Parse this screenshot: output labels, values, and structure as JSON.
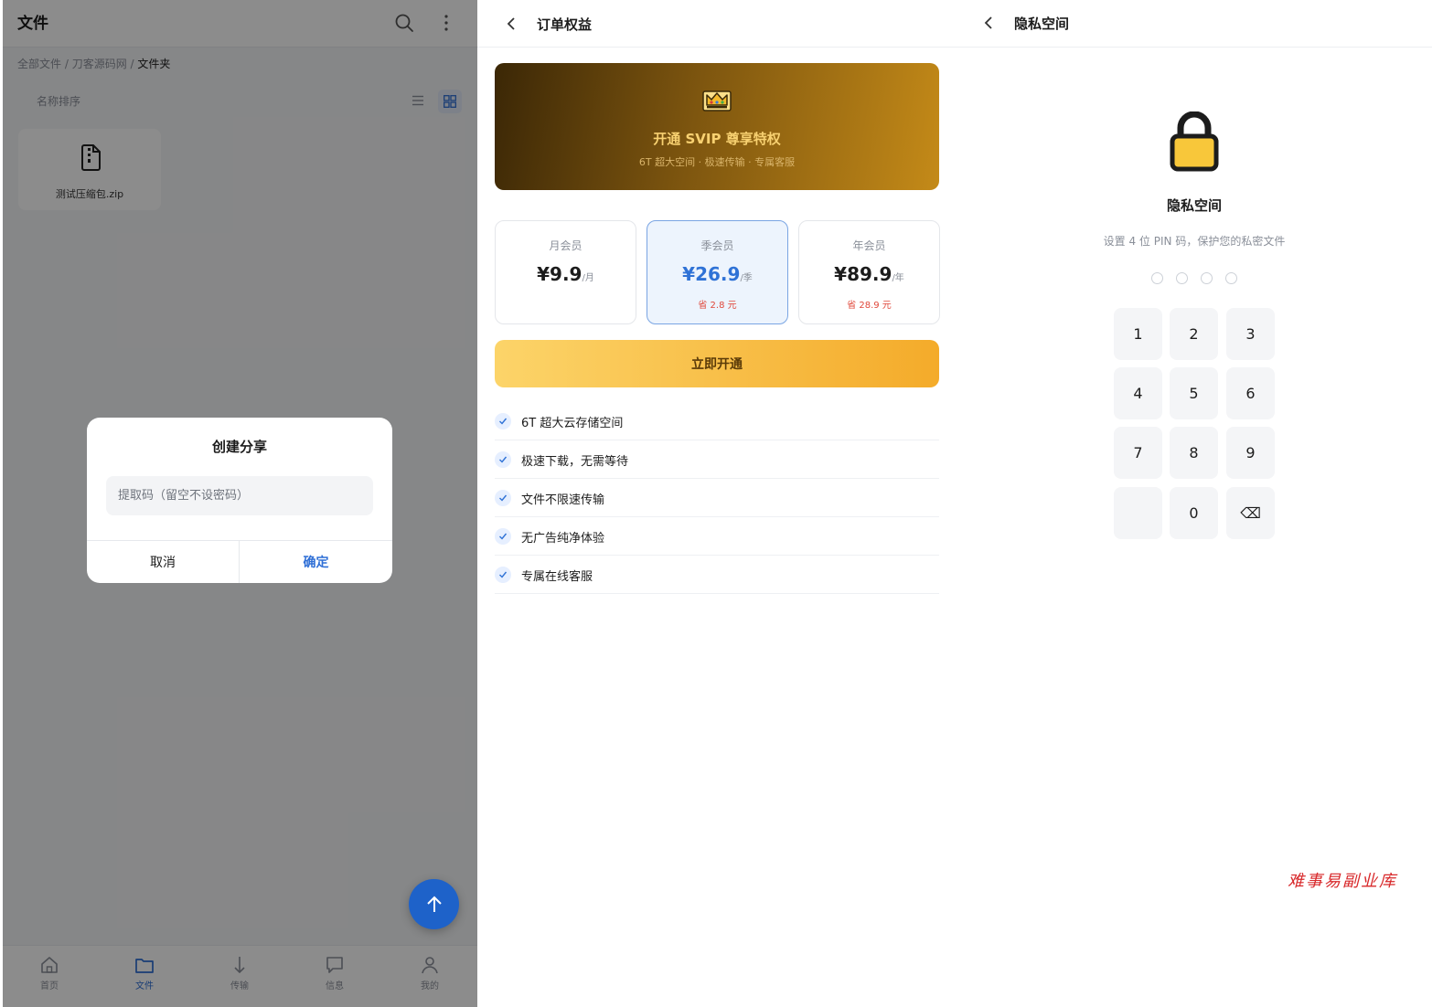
{
  "files": {
    "title": "文件",
    "icons": {
      "search": "search-icon",
      "more": "more-vertical-icon",
      "list": "list-view-icon",
      "grid": "grid-view-icon"
    },
    "breadcrumb": {
      "parts": [
        "全部文件",
        "刀客源码网"
      ],
      "separator": " / ",
      "current": "文件夹"
    },
    "sort_label": "名称排序",
    "file": {
      "name": "测试压缩包.zip",
      "icon": "zip-file-icon"
    },
    "tabs": [
      {
        "label": "首页",
        "icon": "home-icon"
      },
      {
        "label": "文件",
        "icon": "folder-icon"
      },
      {
        "label": "传输",
        "icon": "download-arrow-icon"
      },
      {
        "label": "信息",
        "icon": "message-icon"
      },
      {
        "label": "我的",
        "icon": "user-icon"
      }
    ],
    "active_tab": "文件",
    "dialog": {
      "title": "创建分享",
      "placeholder": "提取码（留空不设密码）",
      "cancel": "取消",
      "confirm": "确定"
    },
    "fab_icon": "arrow-up-icon"
  },
  "order": {
    "title": "订单权益",
    "banner": {
      "title": "开通 SVIP 尊享特权",
      "subtitle": "6T 超大空间 · 极速传输 · 专属客服",
      "icon": "crown-icon"
    },
    "plans": [
      {
        "name": "月会员",
        "price": "¥9.9",
        "unit": "/月",
        "save": ""
      },
      {
        "name": "季会员",
        "price": "¥26.9",
        "unit": "/季",
        "save": "省 2.8 元"
      },
      {
        "name": "年会员",
        "price": "¥89.9",
        "unit": "/年",
        "save": "省 28.9 元"
      }
    ],
    "selected_plan": "季会员",
    "cta": "立即开通",
    "features": [
      "6T 超大云存储空间",
      "极速下载，无需等待",
      "文件不限速传输",
      "无广告纯净体验",
      "专属在线客服"
    ],
    "colors": {
      "accent": "#2f72d6",
      "gold": "#f4ab2a",
      "save": "#e0483b"
    }
  },
  "privacy": {
    "title": "隐私空间",
    "heading": "隐私空间",
    "subtitle": "设置 4 位 PIN 码，保护您的私密文件",
    "pin_length": 4,
    "pin_filled": 0,
    "keys": [
      "1",
      "2",
      "3",
      "4",
      "5",
      "6",
      "7",
      "8",
      "9",
      "",
      "0",
      "⌫"
    ],
    "lock_icon": "lock-icon",
    "backspace_icon": "backspace-icon"
  },
  "watermark": "难事易副业库"
}
